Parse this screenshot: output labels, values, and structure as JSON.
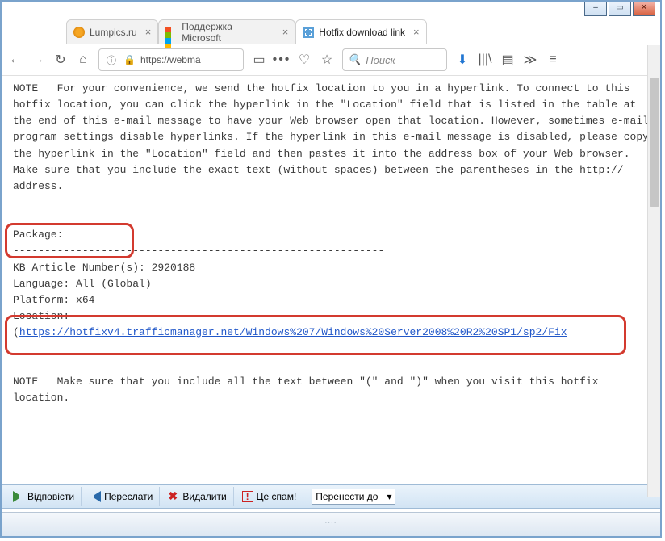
{
  "window": {
    "controls": {
      "min": "–",
      "max": "▭",
      "close": "✕"
    }
  },
  "tabs": [
    {
      "label": "Lumpics.ru"
    },
    {
      "label": "Поддержка Microsoft"
    },
    {
      "label": "Hotfix download link"
    }
  ],
  "nav": {
    "back": "←",
    "fwd": "→",
    "reload": "↻",
    "home": "⌂",
    "info": "ⓘ",
    "url_display": "https://webma",
    "extras": {
      "pause": "▭",
      "dots": "•••",
      "heart": "♡",
      "star": "☆"
    },
    "search_placeholder": "Поиск",
    "search_icon": "🔍",
    "right": {
      "download": "⬇",
      "library": "|||\\",
      "reader": "▤",
      "overflow": "≫",
      "menu": "≡"
    }
  },
  "mail": {
    "note_top": "NOTE   For your convenience, we send the hotfix location to you in a hyperlink. To connect to this hotfix location, you can click the hyperlink in the \"Location\" field that is listed in the table at the end of this e-mail message to have your Web browser open that location. However, sometimes e-mail program settings disable hyperlinks. If the hyperlink in this e-mail message is disabled, please copy the hyperlink in the \"Location\" field and then pastes it into the address box of your Web browser. Make sure that you include the exact text (without spaces) between the parentheses in the http:// address.",
    "package_label": "Package:",
    "dashes": "-----------------------------------------------------------",
    "kb_line": "KB Article Number(s): 2920188",
    "lang_line": "Language: All (Global)",
    "plat_line": "Platform: x64",
    "loc_label": "Location:",
    "loc_url": "https://hotfixv4.trafficmanager.net/Windows%207/Windows%20Server2008%20R2%20SP1/sp2/Fix",
    "note_bottom": "NOTE   Make sure that you include all the text between \"(\" and \")\" when you visit this hotfix location."
  },
  "actions": {
    "reply": "Відповісти",
    "forward": "Переслати",
    "delete": "Видалити",
    "spam": "Це спам!",
    "move_label": "Перенести до",
    "move_caret": "▾"
  },
  "grip": "::::"
}
